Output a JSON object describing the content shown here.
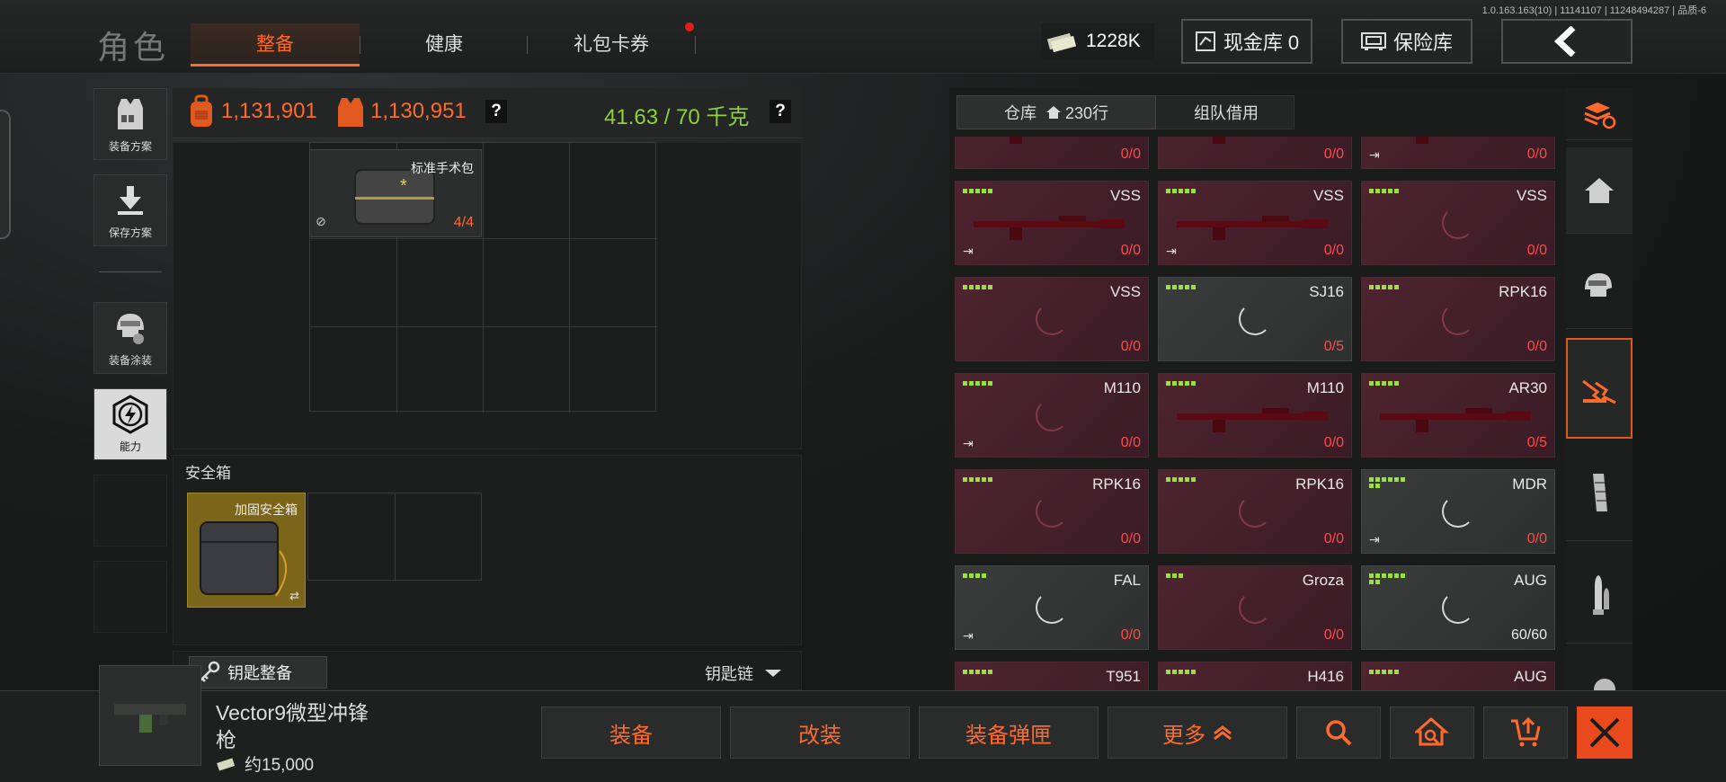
{
  "version": "1.0.163.163(10) | 11141107 | 11248494287 | 品质-6",
  "page_title": "角色",
  "tabs": [
    {
      "label": "整备"
    },
    {
      "label": "健康"
    },
    {
      "label": "礼包卡券"
    }
  ],
  "currency": {
    "value": "1228K"
  },
  "cash_vault": {
    "label": "现金库 0"
  },
  "safe_box_btn": {
    "label": "保险库"
  },
  "sidebar": [
    {
      "label": "装备方案"
    },
    {
      "label": "保存方案"
    },
    {
      "label": "装备涂装"
    },
    {
      "label": "能力"
    }
  ],
  "stats": {
    "backpack_value": "1,131,901",
    "vest_value": "1,130,951",
    "weight": "41.63 / 70 千克",
    "help": "?"
  },
  "backpack_item": {
    "name": "标准手术包",
    "count": "4/4"
  },
  "safe_section": {
    "title": "安全箱",
    "item_name": "加固安全箱"
  },
  "key_section": {
    "button_label": "钥匙整备",
    "dropdown_label": "钥匙链"
  },
  "selected_item": {
    "name_line1": "Vector9微型冲锋",
    "name_line2": "枪",
    "price": "约15,000"
  },
  "actions": {
    "equip": "装备",
    "modify": "改装",
    "equip_mag": "装备弹匣",
    "more": "更多"
  },
  "warehouse": {
    "tab_storage_label": "仓库",
    "tab_storage_rows": "230行",
    "tab_team_label": "组队借用"
  },
  "colors": {
    "accent": "#ff6a2c",
    "weight_green": "#8fd13a",
    "card_red": "#4e2430"
  },
  "cards": [
    {
      "name": "",
      "count": "0/0",
      "style": "red",
      "level": 0,
      "exit": false,
      "gun": true
    },
    {
      "name": "",
      "count": "0/0",
      "style": "red",
      "level": 0,
      "exit": false,
      "gun": true
    },
    {
      "name": "",
      "count": "0/0",
      "style": "red",
      "level": 0,
      "exit": true,
      "gun": true
    },
    {
      "name": "VSS",
      "count": "0/0",
      "style": "red",
      "level": 5,
      "exit": true,
      "gun": true
    },
    {
      "name": "VSS",
      "count": "0/0",
      "style": "red",
      "level": 5,
      "exit": true,
      "gun": true
    },
    {
      "name": "VSS",
      "count": "0/0",
      "style": "red",
      "level": 5,
      "exit": false,
      "gun": false
    },
    {
      "name": "VSS",
      "count": "0/0",
      "style": "red",
      "level": 5,
      "exit": false,
      "gun": false
    },
    {
      "name": "SJ16",
      "count": "0/5",
      "style": "gray",
      "level": 5,
      "exit": false,
      "gun": false
    },
    {
      "name": "RPK16",
      "count": "0/0",
      "style": "red",
      "level": 5,
      "exit": false,
      "gun": false
    },
    {
      "name": "M110",
      "count": "0/0",
      "style": "red",
      "level": 5,
      "exit": true,
      "gun": false
    },
    {
      "name": "M110",
      "count": "0/0",
      "style": "red",
      "level": 5,
      "exit": false,
      "gun": true
    },
    {
      "name": "AR30",
      "count": "0/5",
      "style": "red",
      "level": 5,
      "exit": false,
      "gun": true
    },
    {
      "name": "RPK16",
      "count": "0/0",
      "style": "red",
      "level": 5,
      "exit": false,
      "gun": false
    },
    {
      "name": "RPK16",
      "count": "0/0",
      "style": "red",
      "level": 5,
      "exit": false,
      "gun": false
    },
    {
      "name": "MDR",
      "count": "0/0",
      "style": "gray",
      "level": 8,
      "exit": true,
      "gun": false
    },
    {
      "name": "FAL",
      "count": "0/0",
      "style": "gray",
      "level": 4,
      "exit": true,
      "gun": false
    },
    {
      "name": "Groza",
      "count": "0/0",
      "style": "red",
      "level": 3,
      "exit": false,
      "gun": false
    },
    {
      "name": "AUG",
      "count": "60/60",
      "style": "gray",
      "level": 8,
      "exit": false,
      "gun": false
    },
    {
      "name": "T951",
      "count": "",
      "style": "red",
      "level": 5,
      "exit": false,
      "gun": false
    },
    {
      "name": "H416",
      "count": "",
      "style": "red",
      "level": 5,
      "exit": false,
      "gun": false
    },
    {
      "name": "AUG",
      "count": "",
      "style": "red",
      "level": 5,
      "exit": false,
      "gun": false
    }
  ]
}
